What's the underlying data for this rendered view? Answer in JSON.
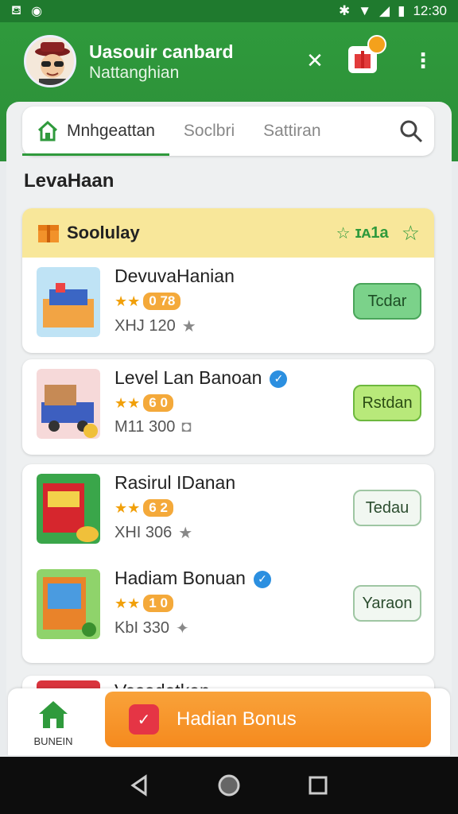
{
  "status": {
    "time": "12:30"
  },
  "header": {
    "user_name": "Uasouir canbard",
    "user_sub": "Nattanghian"
  },
  "tabs": [
    {
      "label": "Mnhgeattan"
    },
    {
      "label": "Soclbri"
    },
    {
      "label": "Sattiran"
    }
  ],
  "section_title": "LevaHaan",
  "group": {
    "title": "Soolulay",
    "rating": "ɪᴀ1a"
  },
  "items": [
    {
      "name": "DevuvaHanian",
      "rating": "0 78",
      "meta": "XHJ 120",
      "action": "Tcdar"
    },
    {
      "name": "Level Lan Banoan",
      "rating": "6 0",
      "meta": "M11 300",
      "action": "Rstdan"
    },
    {
      "name": "Rasirul IDanan",
      "rating": "6 2",
      "meta": "XHI 306",
      "action": "Tedau"
    },
    {
      "name": "Hadiam Bonuan",
      "rating": "1 0",
      "meta": "KbI 330",
      "action": "Yaraon"
    },
    {
      "name": "Vasodotkan"
    }
  ],
  "bottom": {
    "home_label": "BUNEIN",
    "cta_label": "Hadian Bonus"
  },
  "colors": {
    "primary": "#2f9a3c",
    "accent": "#f58a1e",
    "highlight": "#f8e79a"
  }
}
